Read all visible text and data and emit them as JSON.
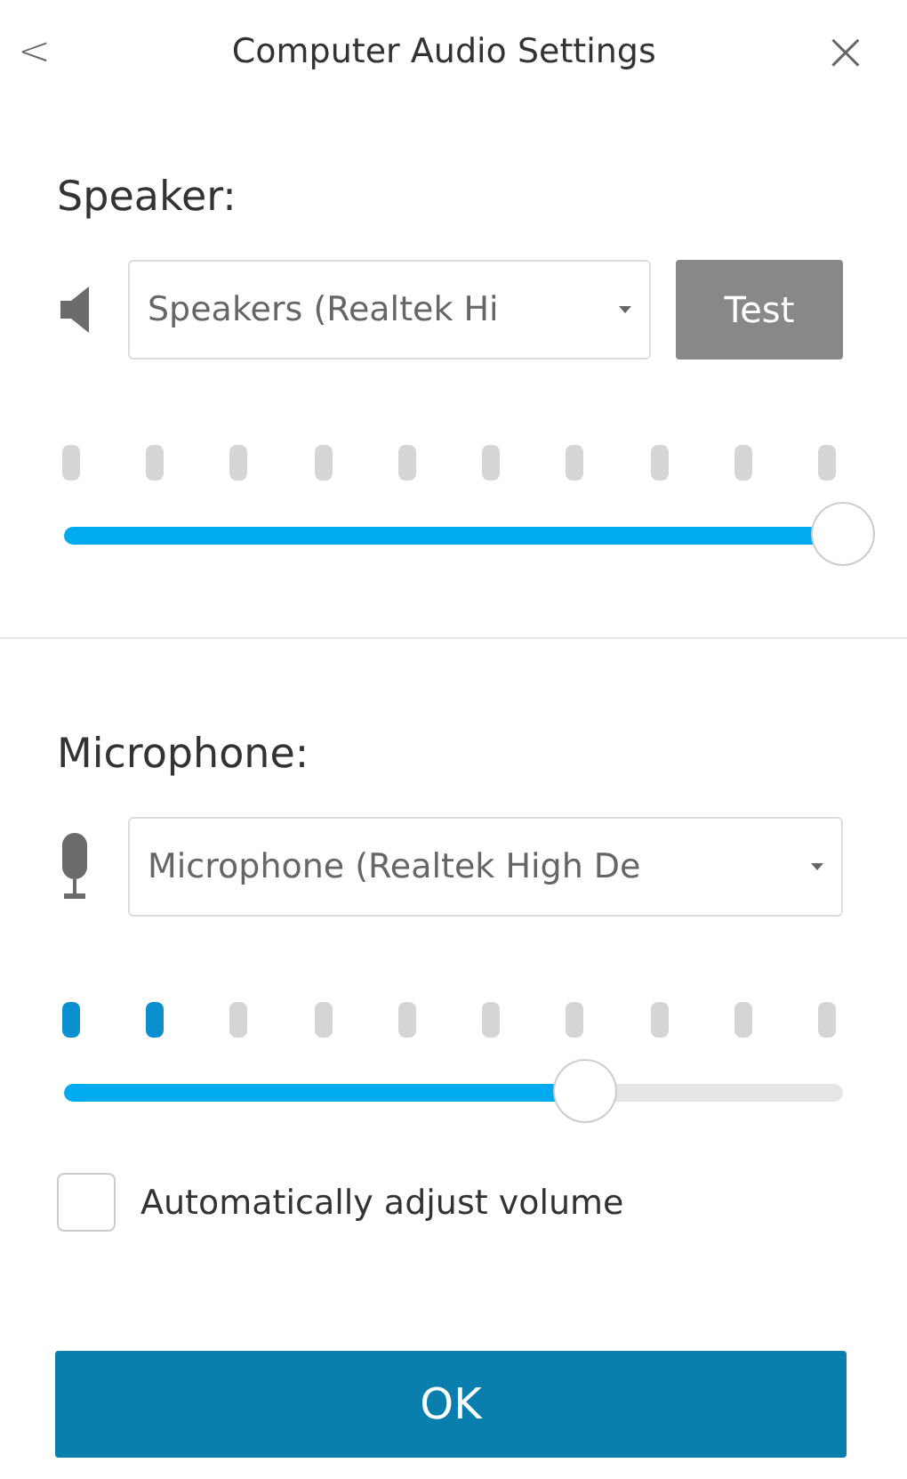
{
  "header": {
    "back": "<",
    "title": "Computer Audio Settings",
    "close": "×"
  },
  "sections": [
    {
      "kind": "speaker",
      "label": "Speaker:",
      "device": "Speakers (Realtek Hi",
      "test_button": "Test",
      "meter_dots": [
        {
          "lit": false
        },
        {
          "lit": false
        },
        {
          "lit": false
        },
        {
          "lit": false
        },
        {
          "lit": false
        },
        {
          "lit": false
        },
        {
          "lit": false
        },
        {
          "lit": false
        },
        {
          "lit": false
        },
        {
          "lit": false
        }
      ],
      "volume": {
        "level": 1
      }
    },
    {
      "kind": "microphone",
      "label": "Microphone:",
      "device": "Microphone (Realtek High De",
      "meter_dots": [
        {
          "lit": true
        },
        {
          "lit": true
        },
        {
          "lit": false
        },
        {
          "lit": false
        },
        {
          "lit": false
        },
        {
          "lit": false
        },
        {
          "lit": false
        },
        {
          "lit": false
        },
        {
          "lit": false
        },
        {
          "lit": false
        }
      ],
      "volume": {
        "level": 0.67
      },
      "auto_adjust": {
        "label": "Automatically adjust volume",
        "checked": false
      }
    }
  ],
  "ok_button": "OK"
}
